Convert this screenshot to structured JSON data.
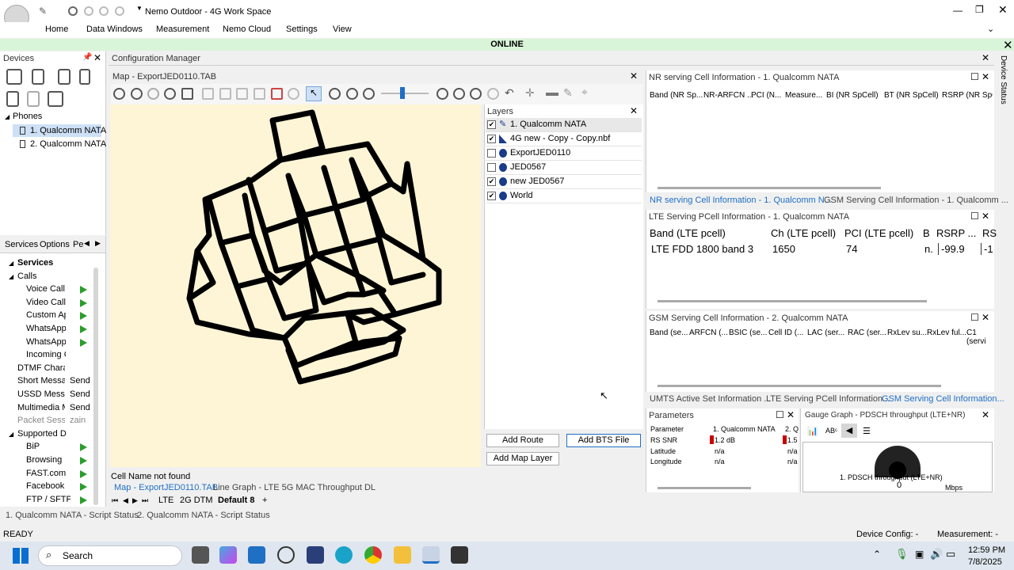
{
  "app": {
    "title": "Nemo Outdoor - 4G Work Space",
    "menu": [
      "Home",
      "Data Windows",
      "Measurement",
      "Nemo Cloud",
      "Settings",
      "View"
    ],
    "status_banner": "ONLINE"
  },
  "devices": {
    "title": "Devices",
    "phones_label": "Phones",
    "phones": [
      "1. Qualcomm NATA",
      "2. Qualcomm NATA"
    ]
  },
  "services": {
    "tabs": [
      "Services",
      "Options",
      "Pe"
    ],
    "root": "Services",
    "calls_label": "Calls",
    "calls": [
      "Voice Call",
      "Video Call",
      "Custom Ap",
      "WhatsApp",
      "WhatsApp",
      "Incoming C"
    ],
    "others": [
      {
        "label": "DTMF Charac",
        "action": ""
      },
      {
        "label": "Short Messag",
        "action": "Send"
      },
      {
        "label": "USSD Messag",
        "action": "Send"
      },
      {
        "label": "Multimedia M",
        "action": "Send"
      },
      {
        "label": "Packet Sessio",
        "action": "zain"
      }
    ],
    "supported_label": "Supported D",
    "supported": [
      "BiP",
      "Browsing",
      "FAST.com",
      "Facebook",
      "FTP / SFTP"
    ]
  },
  "config_manager": {
    "title": "Configuration Manager",
    "map_title": "Map - ExportJED0110.TAB",
    "status_text": "Cell Name not found",
    "bottom_tabs": [
      "Map - ExportJED0110.TAB",
      "Line Graph - LTE 5G MAC Throughput DL"
    ],
    "sheet_tabs": [
      "LTE",
      "2G DTM",
      "Default 8",
      "+"
    ]
  },
  "layers": {
    "title": "Layers",
    "items": [
      {
        "label": "1. Qualcomm NATA",
        "checked": "✔"
      },
      {
        "label": "4G new - Copy - Copy.nbf",
        "checked": "✔"
      },
      {
        "label": "ExportJED0110",
        "checked": ""
      },
      {
        "label": "JED0567",
        "checked": ""
      },
      {
        "label": "new JED0567",
        "checked": "✔"
      },
      {
        "label": "World",
        "checked": "✔"
      }
    ],
    "buttons": {
      "add_route": "Add Route",
      "add_bts": "Add BTS File",
      "add_map_layer": "Add Map Layer"
    }
  },
  "nr_panel": {
    "title": "NR serving Cell Information - 1. Qualcomm NATA",
    "headers": [
      "Band (NR Sp...",
      "NR-ARFCN ...",
      "PCI (N...",
      "Measure...",
      "BI (NR SpCell)",
      "BT (NR SpCell)",
      "RSRP (NR SpCell"
    ],
    "tabs": [
      "NR serving Cell Information - 1. Qualcomm N...",
      "GSM Serving Cell Information - 1. Qualcomm ..."
    ]
  },
  "lte_panel": {
    "title": "LTE Serving PCell Information - 1. Qualcomm NATA",
    "headers": [
      "Band (LTE pcell)",
      "Ch (LTE pcell)",
      "PCI (LTE pcell)",
      "B",
      "RSRP ...",
      "RS"
    ],
    "row": [
      "LTE FDD 1800 band 3",
      "1650",
      "74",
      "n.",
      "-99.9",
      "-1"
    ]
  },
  "gsm_panel": {
    "title": "GSM Serving Cell Information - 2. Qualcomm NATA",
    "headers": [
      "Band (se...",
      "ARFCN (...",
      "BSIC (se...",
      "Cell ID (...",
      "LAC (ser...",
      "RAC (ser...",
      "RxLev su...",
      "RxLev ful...",
      "C1 (servi"
    ],
    "tabs": [
      "UMTS Active Set Information ...",
      "LTE Serving PCell Information...",
      "GSM Serving Cell Information..."
    ]
  },
  "params": {
    "title": "Parameters",
    "col_param": "Parameter",
    "col_dev1": "1. Qualcomm NATA",
    "col_dev2": "2. Q",
    "rows": [
      {
        "name": "RS SNR",
        "v1": "1.2 dB",
        "v2": "1.5"
      },
      {
        "name": "Latitude",
        "v1": "n/a",
        "v2": "n/a"
      },
      {
        "name": "Longitude",
        "v1": "n/a",
        "v2": "n/a"
      }
    ]
  },
  "gauge": {
    "title": "Gauge Graph - PDSCH throughput (LTE+NR)",
    "label": "1. PDSCH throughput (LTE+NR)",
    "value": "0",
    "unit": "Mbps"
  },
  "script_tabs": [
    "1. Qualcomm NATA - Script Status",
    "2. Qualcomm NATA - Script Status"
  ],
  "statusbar": {
    "left": "READY",
    "device_config": "Device Config: -",
    "measurement": "Measurement: -"
  },
  "taskbar": {
    "search": "Search",
    "time": "12:59 PM",
    "date": "7/8/2025"
  },
  "side_tab": "Device Status"
}
